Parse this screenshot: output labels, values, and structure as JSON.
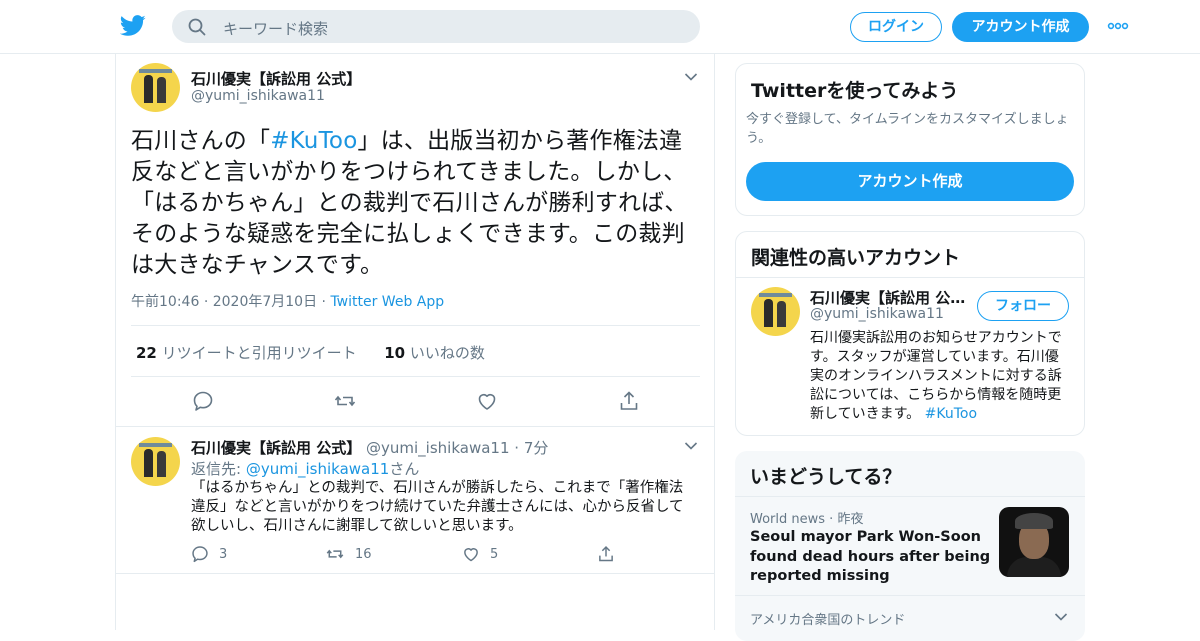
{
  "header": {
    "search_placeholder": "キーワード検索",
    "login_label": "ログイン",
    "signup_label": "アカウント作成",
    "brand_color": "#1da1f2"
  },
  "tweet": {
    "name": "石川優実【訴訟用 公式】",
    "handle": "@yumi_ishikawa11",
    "text_pre": "石川さんの「",
    "hashtag": "#KuToo",
    "text_post": "」は、出版当初から著作権法違反などと言いがかりをつけられてきました。しかし、「はるかちゃん」との裁判で石川さんが勝利すれば、そのような疑惑を完全に払しょくできます。この裁判は大きなチャンスです。",
    "time": "午前10:46",
    "date": "2020年7月10日",
    "source": "Twitter Web App",
    "retweets_count": "22",
    "retweets_label": "リツイートと引用リツイート",
    "likes_count": "10",
    "likes_label": "いいねの数"
  },
  "reply": {
    "name": "石川優実【訴訟用 公式】",
    "handle": "@yumi_ishikawa11",
    "time": "7分",
    "reply_prefix": "返信先: ",
    "reply_to": "@yumi_ishikawa11",
    "reply_suffix": "さん",
    "text": "「はるかちゃん」との裁判で、石川さんが勝訴したら、これまで「著作権法違反」などと言いがかりをつけ続けていた弁護士さんには、心から反省して欲しいし、石川さんに謝罪して欲しいと思います。",
    "reply_count": "3",
    "retweet_count": "16",
    "like_count": "5"
  },
  "sidebar": {
    "try_title": "Twitterを使ってみよう",
    "try_sub": "今すぐ登録して、タイムラインをカスタマイズしましょう。",
    "try_button": "アカウント作成",
    "related_title": "関連性の高いアカウント",
    "related_name": "石川優実【訴訟用 公式】",
    "related_handle": "@yumi_ishikawa11",
    "follow_label": "フォロー",
    "related_bio": "石川優実訴訟用のお知らせアカウントです。スタッフが運営しています。石川優実のオンラインハラスメントに対する訴訟については、こちらから情報を随時更新していきます。 ",
    "related_bio_hashtag": "#KuToo",
    "trends_title": "いまどうしてる？",
    "trend_source": "World news",
    "trend_time": "昨夜",
    "trend_headline": "Seoul mayor Park Won-Soon found dead hours after being reported missing",
    "trend_region": "アメリカ合衆国のトレンド"
  }
}
